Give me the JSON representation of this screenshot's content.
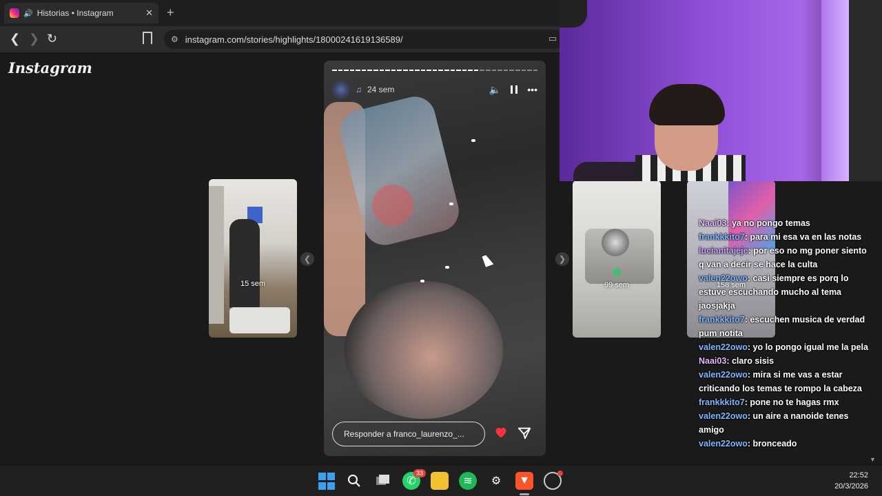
{
  "browser": {
    "tab_title": "Historias • Instagram",
    "tab_close": "✕",
    "new_tab": "+",
    "url": "instagram.com/stories/highlights/18000241619136589/",
    "back": "❮",
    "forward": "❯",
    "reload": "↻"
  },
  "instagram": {
    "logo": "Instagram",
    "previews": [
      {
        "label": "15 sem"
      },
      {
        "label": "99 sem"
      },
      {
        "label": "158 sem"
      }
    ],
    "story": {
      "time": "24 sem",
      "reply_placeholder": "Responder a franco_laurenzo_..."
    }
  },
  "chat": [
    {
      "user": "Naai03",
      "color": "#e6b7ff",
      "text": " ya no pongo temas"
    },
    {
      "user": "frankkkito7",
      "color": "#7fb8ff",
      "text": " para mi esa va en las notas"
    },
    {
      "user": "lucianitajeje",
      "color": "#c9a0ff",
      "text": " por eso no mg poner siento q van a decir se hace la culta"
    },
    {
      "user": "valen22owo",
      "color": "#7fb8ff",
      "text": " casi siempre es porq lo estuve escuchando mucho al tema jaosjakja"
    },
    {
      "user": "frankkkito7",
      "color": "#7fb8ff",
      "text": " escuchen musica de verdad pum notita"
    },
    {
      "user": "valen22owo",
      "color": "#7fb8ff",
      "text": " yo lo pongo igual me la pela"
    },
    {
      "user": "Naai03",
      "color": "#e6b7ff",
      "text": " claro sisis"
    },
    {
      "user": "valen22owo",
      "color": "#7fb8ff",
      "text": " mira si me vas a estar criticando los temas te rompo la cabeza"
    },
    {
      "user": "frankkkito7",
      "color": "#7fb8ff",
      "text": " pone no te hagas rmx"
    },
    {
      "user": "valen22owo",
      "color": "#7fb8ff",
      "text": " un aire a nanoide tenes amigo"
    },
    {
      "user": "valen22owo",
      "color": "#7fb8ff",
      "text": " bronceado"
    }
  ],
  "taskbar": {
    "whatsapp_badge": "33",
    "time": "22:52",
    "date": "20/3/2026"
  }
}
